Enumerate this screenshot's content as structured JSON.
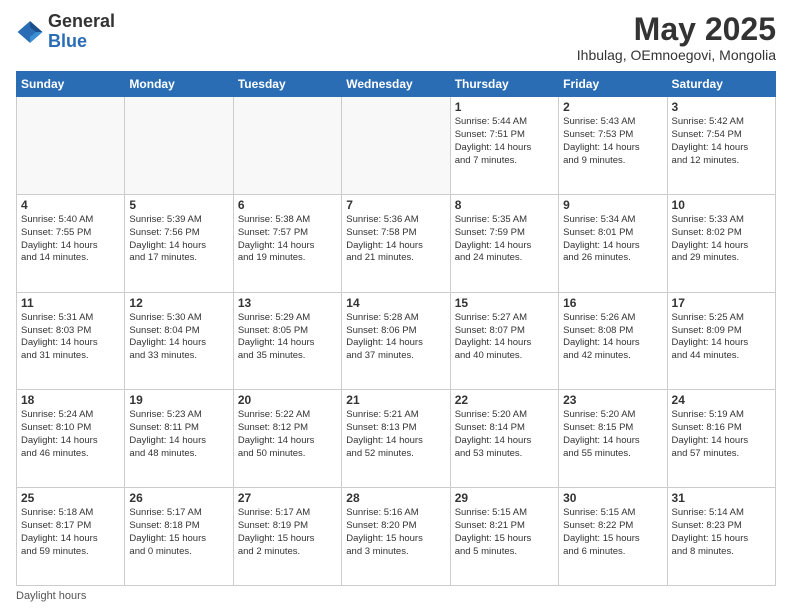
{
  "header": {
    "logo_general": "General",
    "logo_blue": "Blue",
    "month_title": "May 2025",
    "location": "Ihbulag, OEmnoegovi, Mongolia"
  },
  "footer": {
    "daylight_label": "Daylight hours"
  },
  "weekdays": [
    "Sunday",
    "Monday",
    "Tuesday",
    "Wednesday",
    "Thursday",
    "Friday",
    "Saturday"
  ],
  "weeks": [
    [
      {
        "day": "",
        "info": ""
      },
      {
        "day": "",
        "info": ""
      },
      {
        "day": "",
        "info": ""
      },
      {
        "day": "",
        "info": ""
      },
      {
        "day": "1",
        "info": "Sunrise: 5:44 AM\nSunset: 7:51 PM\nDaylight: 14 hours\nand 7 minutes."
      },
      {
        "day": "2",
        "info": "Sunrise: 5:43 AM\nSunset: 7:53 PM\nDaylight: 14 hours\nand 9 minutes."
      },
      {
        "day": "3",
        "info": "Sunrise: 5:42 AM\nSunset: 7:54 PM\nDaylight: 14 hours\nand 12 minutes."
      }
    ],
    [
      {
        "day": "4",
        "info": "Sunrise: 5:40 AM\nSunset: 7:55 PM\nDaylight: 14 hours\nand 14 minutes."
      },
      {
        "day": "5",
        "info": "Sunrise: 5:39 AM\nSunset: 7:56 PM\nDaylight: 14 hours\nand 17 minutes."
      },
      {
        "day": "6",
        "info": "Sunrise: 5:38 AM\nSunset: 7:57 PM\nDaylight: 14 hours\nand 19 minutes."
      },
      {
        "day": "7",
        "info": "Sunrise: 5:36 AM\nSunset: 7:58 PM\nDaylight: 14 hours\nand 21 minutes."
      },
      {
        "day": "8",
        "info": "Sunrise: 5:35 AM\nSunset: 7:59 PM\nDaylight: 14 hours\nand 24 minutes."
      },
      {
        "day": "9",
        "info": "Sunrise: 5:34 AM\nSunset: 8:01 PM\nDaylight: 14 hours\nand 26 minutes."
      },
      {
        "day": "10",
        "info": "Sunrise: 5:33 AM\nSunset: 8:02 PM\nDaylight: 14 hours\nand 29 minutes."
      }
    ],
    [
      {
        "day": "11",
        "info": "Sunrise: 5:31 AM\nSunset: 8:03 PM\nDaylight: 14 hours\nand 31 minutes."
      },
      {
        "day": "12",
        "info": "Sunrise: 5:30 AM\nSunset: 8:04 PM\nDaylight: 14 hours\nand 33 minutes."
      },
      {
        "day": "13",
        "info": "Sunrise: 5:29 AM\nSunset: 8:05 PM\nDaylight: 14 hours\nand 35 minutes."
      },
      {
        "day": "14",
        "info": "Sunrise: 5:28 AM\nSunset: 8:06 PM\nDaylight: 14 hours\nand 37 minutes."
      },
      {
        "day": "15",
        "info": "Sunrise: 5:27 AM\nSunset: 8:07 PM\nDaylight: 14 hours\nand 40 minutes."
      },
      {
        "day": "16",
        "info": "Sunrise: 5:26 AM\nSunset: 8:08 PM\nDaylight: 14 hours\nand 42 minutes."
      },
      {
        "day": "17",
        "info": "Sunrise: 5:25 AM\nSunset: 8:09 PM\nDaylight: 14 hours\nand 44 minutes."
      }
    ],
    [
      {
        "day": "18",
        "info": "Sunrise: 5:24 AM\nSunset: 8:10 PM\nDaylight: 14 hours\nand 46 minutes."
      },
      {
        "day": "19",
        "info": "Sunrise: 5:23 AM\nSunset: 8:11 PM\nDaylight: 14 hours\nand 48 minutes."
      },
      {
        "day": "20",
        "info": "Sunrise: 5:22 AM\nSunset: 8:12 PM\nDaylight: 14 hours\nand 50 minutes."
      },
      {
        "day": "21",
        "info": "Sunrise: 5:21 AM\nSunset: 8:13 PM\nDaylight: 14 hours\nand 52 minutes."
      },
      {
        "day": "22",
        "info": "Sunrise: 5:20 AM\nSunset: 8:14 PM\nDaylight: 14 hours\nand 53 minutes."
      },
      {
        "day": "23",
        "info": "Sunrise: 5:20 AM\nSunset: 8:15 PM\nDaylight: 14 hours\nand 55 minutes."
      },
      {
        "day": "24",
        "info": "Sunrise: 5:19 AM\nSunset: 8:16 PM\nDaylight: 14 hours\nand 57 minutes."
      }
    ],
    [
      {
        "day": "25",
        "info": "Sunrise: 5:18 AM\nSunset: 8:17 PM\nDaylight: 14 hours\nand 59 minutes."
      },
      {
        "day": "26",
        "info": "Sunrise: 5:17 AM\nSunset: 8:18 PM\nDaylight: 15 hours\nand 0 minutes."
      },
      {
        "day": "27",
        "info": "Sunrise: 5:17 AM\nSunset: 8:19 PM\nDaylight: 15 hours\nand 2 minutes."
      },
      {
        "day": "28",
        "info": "Sunrise: 5:16 AM\nSunset: 8:20 PM\nDaylight: 15 hours\nand 3 minutes."
      },
      {
        "day": "29",
        "info": "Sunrise: 5:15 AM\nSunset: 8:21 PM\nDaylight: 15 hours\nand 5 minutes."
      },
      {
        "day": "30",
        "info": "Sunrise: 5:15 AM\nSunset: 8:22 PM\nDaylight: 15 hours\nand 6 minutes."
      },
      {
        "day": "31",
        "info": "Sunrise: 5:14 AM\nSunset: 8:23 PM\nDaylight: 15 hours\nand 8 minutes."
      }
    ]
  ]
}
